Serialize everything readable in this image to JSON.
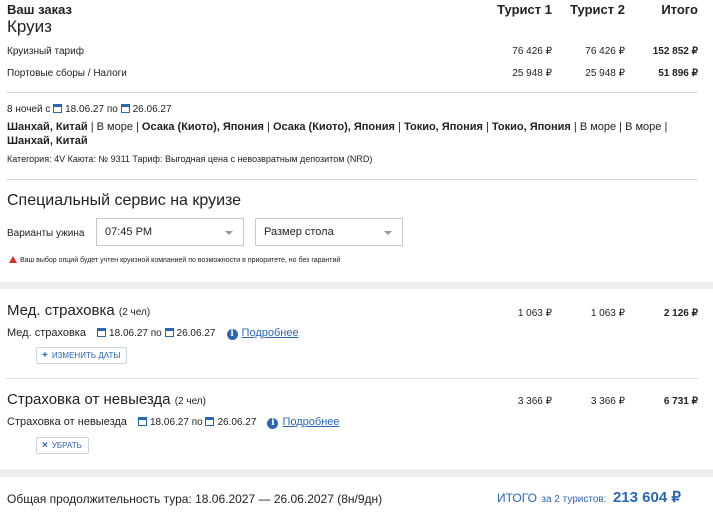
{
  "header": {
    "order_label": "Ваш заказ",
    "product": "Круиз",
    "col_tourist1": "Турист 1",
    "col_tourist2": "Турист 2",
    "col_total": "Итого"
  },
  "price_rows": [
    {
      "label": "Круизный тариф",
      "t1": "76 426 ₽",
      "t2": "76 426 ₽",
      "total": "152 852 ₽"
    },
    {
      "label": "Портовые сборы / Налоги",
      "t1": "25 948 ₽",
      "t2": "25 948 ₽",
      "total": "51 896 ₽"
    }
  ],
  "itinerary": {
    "nights_prefix": "8 ночей с",
    "date_from": "18.06.27",
    "by": "по",
    "date_to": "26.06.27",
    "route_line1": [
      {
        "text": "Шанхай, Китай",
        "bold": true
      },
      {
        "text": " | В море | ",
        "bold": false
      },
      {
        "text": "Осака (Киото), Япония",
        "bold": true
      },
      {
        "text": " | ",
        "bold": false
      },
      {
        "text": "Осака (Киото), Япония",
        "bold": true
      },
      {
        "text": " | ",
        "bold": false
      },
      {
        "text": "Токио, Япония",
        "bold": true
      },
      {
        "text": " | ",
        "bold": false
      },
      {
        "text": "Токио, Япония",
        "bold": true
      },
      {
        "text": " | В море | В море |",
        "bold": false
      }
    ],
    "route_line2": "Шанхай, Китай",
    "category": "Категория: 4V  Каюта: № 9311  Тариф: Выгодная цена с невозвратным депозитом (NRD)"
  },
  "special_service": {
    "title": "Специальный сервис на круизе",
    "dinner_label": "Варианты ужина",
    "dinner_value": "07:45 PM",
    "table_size_value": "Размер стола",
    "warning": "Ваш выбор опций будет учтен круизной компанией по возможности в приоритете, но без гарантий"
  },
  "insurance_medical": {
    "title": "Мед. страховка",
    "count": "(2 чел)",
    "t1": "1 063 ₽",
    "t2": "1 063 ₽",
    "total": "2 126 ₽",
    "sub_label": "Мед. страховка",
    "date_from": "18.06.27",
    "by": "по",
    "date_to": "26.06.27",
    "more_link": "Подробнее",
    "change_dates_button": "ИЗМЕНИТЬ ДАТЫ"
  },
  "insurance_cancel": {
    "title": "Страховка от невыезда",
    "count": "(2 чел)",
    "t1": "3 366 ₽",
    "t2": "3 366 ₽",
    "total": "6 731 ₽",
    "sub_label": "Страховка от невыезда",
    "date_from": "18.06.27",
    "by": "по",
    "date_to": "26.06.27",
    "more_link": "Подробнее",
    "remove_button": "УБРАТЬ"
  },
  "footer": {
    "duration": "Общая продолжительность тура: 18.06.2027 — 26.06.2027 (8н/9дн)",
    "total_label": "ИТОГО",
    "total_for": "за 2 туристов:",
    "total_value": "213 604 ₽"
  },
  "colors": {
    "accent": "#2a67b3",
    "warning": "#d9302a"
  }
}
